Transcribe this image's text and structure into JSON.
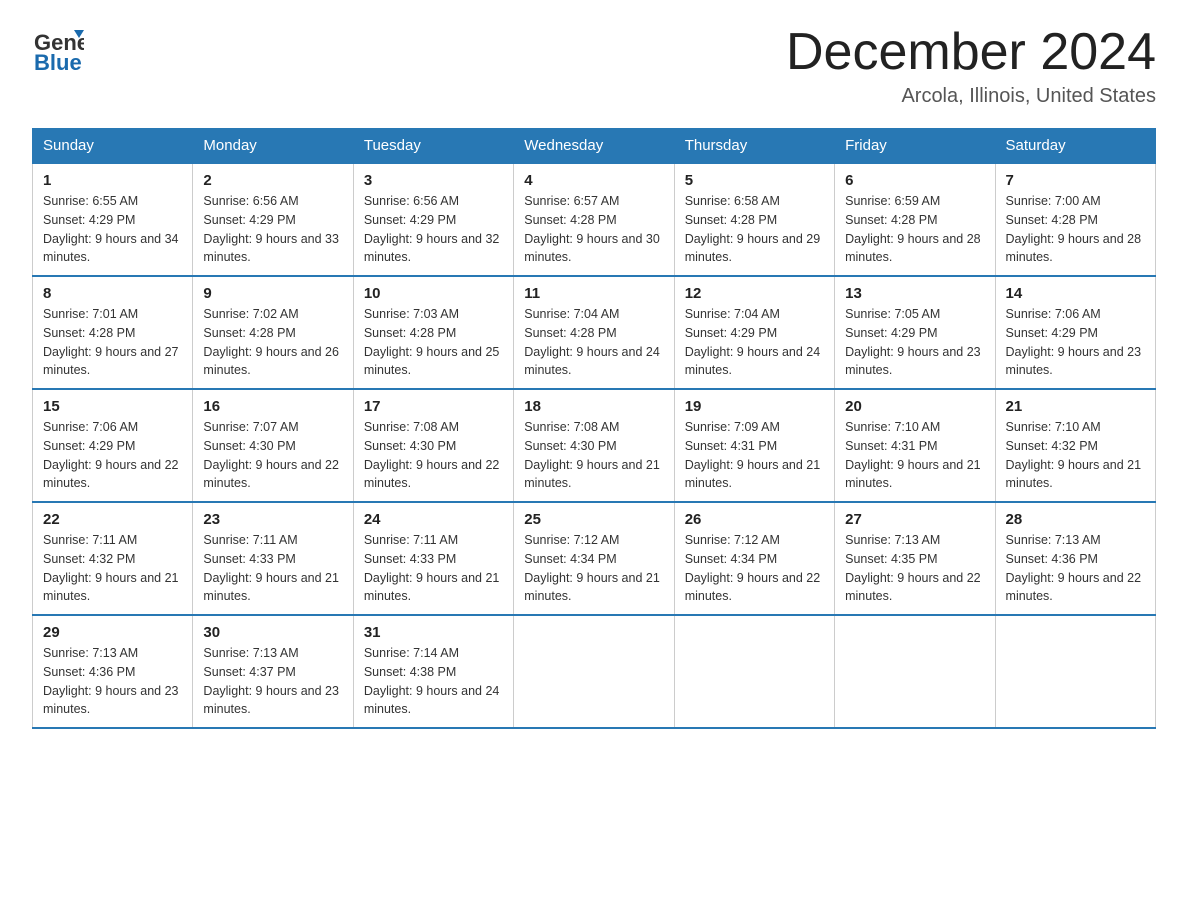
{
  "header": {
    "logo_line1": "General",
    "logo_line2": "Blue",
    "title": "December 2024",
    "location": "Arcola, Illinois, United States"
  },
  "calendar": {
    "days_of_week": [
      "Sunday",
      "Monday",
      "Tuesday",
      "Wednesday",
      "Thursday",
      "Friday",
      "Saturday"
    ],
    "weeks": [
      [
        {
          "day": "1",
          "sunrise": "6:55 AM",
          "sunset": "4:29 PM",
          "daylight": "9 hours and 34 minutes."
        },
        {
          "day": "2",
          "sunrise": "6:56 AM",
          "sunset": "4:29 PM",
          "daylight": "9 hours and 33 minutes."
        },
        {
          "day": "3",
          "sunrise": "6:56 AM",
          "sunset": "4:29 PM",
          "daylight": "9 hours and 32 minutes."
        },
        {
          "day": "4",
          "sunrise": "6:57 AM",
          "sunset": "4:28 PM",
          "daylight": "9 hours and 30 minutes."
        },
        {
          "day": "5",
          "sunrise": "6:58 AM",
          "sunset": "4:28 PM",
          "daylight": "9 hours and 29 minutes."
        },
        {
          "day": "6",
          "sunrise": "6:59 AM",
          "sunset": "4:28 PM",
          "daylight": "9 hours and 28 minutes."
        },
        {
          "day": "7",
          "sunrise": "7:00 AM",
          "sunset": "4:28 PM",
          "daylight": "9 hours and 28 minutes."
        }
      ],
      [
        {
          "day": "8",
          "sunrise": "7:01 AM",
          "sunset": "4:28 PM",
          "daylight": "9 hours and 27 minutes."
        },
        {
          "day": "9",
          "sunrise": "7:02 AM",
          "sunset": "4:28 PM",
          "daylight": "9 hours and 26 minutes."
        },
        {
          "day": "10",
          "sunrise": "7:03 AM",
          "sunset": "4:28 PM",
          "daylight": "9 hours and 25 minutes."
        },
        {
          "day": "11",
          "sunrise": "7:04 AM",
          "sunset": "4:28 PM",
          "daylight": "9 hours and 24 minutes."
        },
        {
          "day": "12",
          "sunrise": "7:04 AM",
          "sunset": "4:29 PM",
          "daylight": "9 hours and 24 minutes."
        },
        {
          "day": "13",
          "sunrise": "7:05 AM",
          "sunset": "4:29 PM",
          "daylight": "9 hours and 23 minutes."
        },
        {
          "day": "14",
          "sunrise": "7:06 AM",
          "sunset": "4:29 PM",
          "daylight": "9 hours and 23 minutes."
        }
      ],
      [
        {
          "day": "15",
          "sunrise": "7:06 AM",
          "sunset": "4:29 PM",
          "daylight": "9 hours and 22 minutes."
        },
        {
          "day": "16",
          "sunrise": "7:07 AM",
          "sunset": "4:30 PM",
          "daylight": "9 hours and 22 minutes."
        },
        {
          "day": "17",
          "sunrise": "7:08 AM",
          "sunset": "4:30 PM",
          "daylight": "9 hours and 22 minutes."
        },
        {
          "day": "18",
          "sunrise": "7:08 AM",
          "sunset": "4:30 PM",
          "daylight": "9 hours and 21 minutes."
        },
        {
          "day": "19",
          "sunrise": "7:09 AM",
          "sunset": "4:31 PM",
          "daylight": "9 hours and 21 minutes."
        },
        {
          "day": "20",
          "sunrise": "7:10 AM",
          "sunset": "4:31 PM",
          "daylight": "9 hours and 21 minutes."
        },
        {
          "day": "21",
          "sunrise": "7:10 AM",
          "sunset": "4:32 PM",
          "daylight": "9 hours and 21 minutes."
        }
      ],
      [
        {
          "day": "22",
          "sunrise": "7:11 AM",
          "sunset": "4:32 PM",
          "daylight": "9 hours and 21 minutes."
        },
        {
          "day": "23",
          "sunrise": "7:11 AM",
          "sunset": "4:33 PM",
          "daylight": "9 hours and 21 minutes."
        },
        {
          "day": "24",
          "sunrise": "7:11 AM",
          "sunset": "4:33 PM",
          "daylight": "9 hours and 21 minutes."
        },
        {
          "day": "25",
          "sunrise": "7:12 AM",
          "sunset": "4:34 PM",
          "daylight": "9 hours and 21 minutes."
        },
        {
          "day": "26",
          "sunrise": "7:12 AM",
          "sunset": "4:34 PM",
          "daylight": "9 hours and 22 minutes."
        },
        {
          "day": "27",
          "sunrise": "7:13 AM",
          "sunset": "4:35 PM",
          "daylight": "9 hours and 22 minutes."
        },
        {
          "day": "28",
          "sunrise": "7:13 AM",
          "sunset": "4:36 PM",
          "daylight": "9 hours and 22 minutes."
        }
      ],
      [
        {
          "day": "29",
          "sunrise": "7:13 AM",
          "sunset": "4:36 PM",
          "daylight": "9 hours and 23 minutes."
        },
        {
          "day": "30",
          "sunrise": "7:13 AM",
          "sunset": "4:37 PM",
          "daylight": "9 hours and 23 minutes."
        },
        {
          "day": "31",
          "sunrise": "7:14 AM",
          "sunset": "4:38 PM",
          "daylight": "9 hours and 24 minutes."
        },
        null,
        null,
        null,
        null
      ]
    ],
    "labels": {
      "sunrise": "Sunrise: ",
      "sunset": "Sunset: ",
      "daylight": "Daylight: "
    }
  }
}
